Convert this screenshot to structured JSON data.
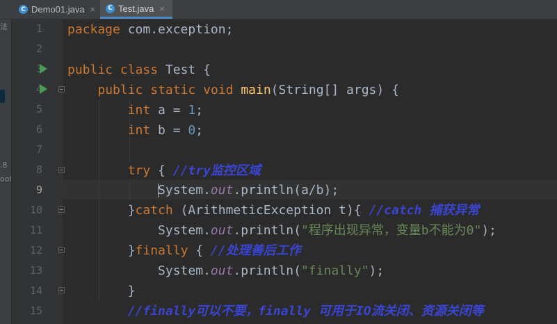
{
  "tabs": [
    {
      "icon": "C",
      "label": "Demo01.java",
      "close": "×"
    },
    {
      "icon": "C",
      "label": "Test.java",
      "close": "×"
    }
  ],
  "side_panel": {
    "marks": [
      "法",
      ".8",
      "oot"
    ]
  },
  "line_numbers": [
    "1",
    "2",
    "3",
    "4",
    "5",
    "6",
    "7",
    "8",
    "9",
    "10",
    "11",
    "12",
    "13",
    "14",
    "15"
  ],
  "current_line": "9",
  "code": {
    "l1": {
      "kw": "package",
      "rest": " com.exception;"
    },
    "l3": {
      "kw1": "public",
      "kw2": "class",
      "name": " Test {"
    },
    "l4": {
      "kw1": "public",
      "kw2": "static",
      "kw3": "void",
      "fn": "main",
      "rest": "(String[] args) {"
    },
    "l5": {
      "kw": "int",
      "mid": " a = ",
      "num": "1",
      "end": ";"
    },
    "l6": {
      "kw": "int",
      "mid": " b = ",
      "num": "0",
      "end": ";"
    },
    "l8": {
      "kw": "try",
      "mid": " { ",
      "comment": "//try监控区域"
    },
    "l9": {
      "obj": "System",
      "dot1": ".",
      "field": "out",
      "call": ".println(a/b);"
    },
    "l10": {
      "pre": "}",
      "kw": "catch",
      "mid": " (ArithmeticException t){ ",
      "comment": "//catch 捕获异常"
    },
    "l11": {
      "obj": "System.",
      "field": "out",
      "call": ".println(",
      "str": "\"程序出现异常，变量b不能为0\"",
      "end": ");"
    },
    "l12": {
      "pre": "}",
      "kw": "finally",
      "mid": " { ",
      "comment": "//处理善后工作"
    },
    "l13": {
      "obj": "System.",
      "field": "out",
      "call": ".println(",
      "str": "\"finally\"",
      "end": ");"
    },
    "l14": {
      "brace": "}"
    },
    "l15": {
      "comment": "//finally可以不要，finally 可用于IO流关闭、资源关闭等"
    }
  },
  "colors": {
    "keyword": "#cc7832",
    "function": "#ffc66d",
    "number": "#6897bb",
    "string": "#6a8759",
    "field": "#9876aa",
    "comment": "#3a45d3",
    "text": "#a9b7c6",
    "background": "#2b2b2b"
  }
}
